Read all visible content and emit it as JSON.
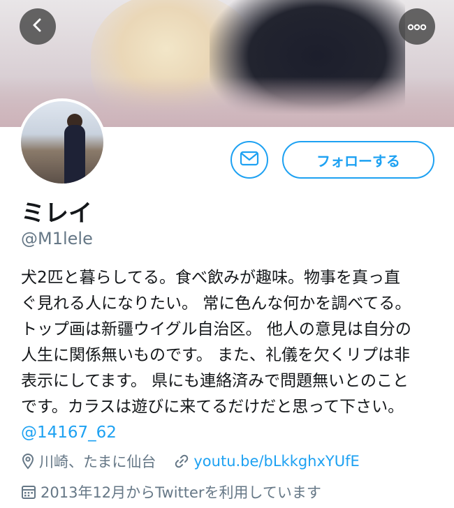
{
  "header": {
    "back_icon": "chevron-left-icon",
    "more_icon": "more-horizontal-icon"
  },
  "actions": {
    "message_icon": "mail-icon",
    "follow_label": "フォローする"
  },
  "profile": {
    "name": "ミレイ",
    "handle": "@M1lele",
    "bio_lines": [
      "犬2匹と暮らしてる。食べ飲みが趣味。物事を真っ直",
      "ぐ見れる人になりたい。 常に色んな何かを調べてる。",
      "トップ画は新疆ウイグル自治区。 他人の意見は自分の",
      "人生に関係無いものです。 また、礼儀を欠くリプは非",
      "表示にしてます。 県にも連絡済みで問題無いとのこと",
      "です。カラスは遊びに来てるだけだと思って下さい。"
    ],
    "mention": "@14167_62",
    "location": "川崎、たまに仙台",
    "location_icon": "location-pin-icon",
    "link": "youtu.be/bLkkghxYUfE",
    "link_icon": "link-icon",
    "joined": "2013年12月からTwitterを利用しています",
    "joined_icon": "calendar-icon"
  },
  "colors": {
    "accent": "#1da1f2",
    "secondary_text": "#657786",
    "primary_text": "#14171a"
  }
}
